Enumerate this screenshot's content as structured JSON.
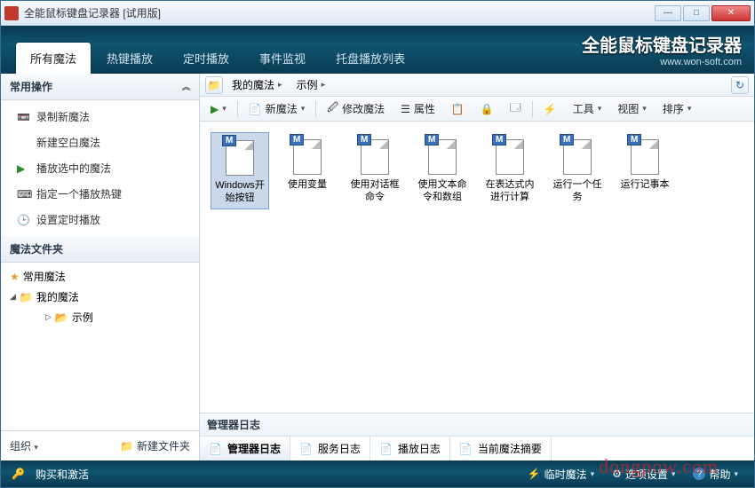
{
  "window": {
    "title": "全能鼠标键盘记录器 [试用版]"
  },
  "brand": {
    "main": "全能鼠标键盘记录器",
    "sub": "www.won-soft.com"
  },
  "tabs": [
    "所有魔法",
    "热键播放",
    "定时播放",
    "事件监视",
    "托盘播放列表"
  ],
  "sidebar": {
    "section1_title": "常用操作",
    "ops": [
      "录制新魔法",
      "新建空白魔法",
      "播放选中的魔法",
      "指定一个播放热键",
      "设置定时播放"
    ],
    "section2_title": "魔法文件夹",
    "tree": {
      "fav": "常用魔法",
      "my": "我的魔法",
      "sample": "示例"
    },
    "footer": {
      "org": "组织",
      "newfolder": "新建文件夹"
    }
  },
  "breadcrumb": {
    "root": "我的魔法",
    "child": "示例"
  },
  "toolbar": {
    "new": "新魔法",
    "edit": "修改魔法",
    "props": "属性",
    "tools": "工具",
    "view": "视图",
    "sort": "排序"
  },
  "files": [
    {
      "name": "Windows开始按钮",
      "selected": true
    },
    {
      "name": "使用变量",
      "selected": false
    },
    {
      "name": "使用对话框命令",
      "selected": false
    },
    {
      "name": "使用文本命令和数组",
      "selected": false
    },
    {
      "name": "在表达式内进行计算",
      "selected": false
    },
    {
      "name": "运行一个任务",
      "selected": false
    },
    {
      "name": "运行记事本",
      "selected": false
    }
  ],
  "bottom": {
    "title": "管理器日志",
    "tabs": [
      "管理器日志",
      "服务日志",
      "播放日志",
      "当前魔法摘要"
    ]
  },
  "status": {
    "buy": "购买和激活",
    "temp": "临时魔法",
    "opts": "选项设置",
    "help": "帮助"
  },
  "watermark": "dongpow.com"
}
